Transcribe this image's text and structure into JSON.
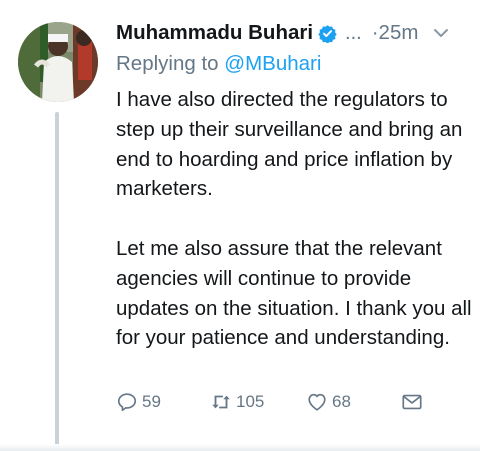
{
  "tweet": {
    "author_name": "Muhammadu Buhari",
    "handle_truncated": "...",
    "time": "·25m",
    "replying_prefix": "Replying to ",
    "replying_handle": "@MBuhari",
    "paragraphs": [
      "I have also directed the regulators to step up their surveillance and bring an end to hoarding and price inflation by marketers.",
      "Let me also assure that the relevant agencies will continue to provide updates on the situation. I thank you all for your patience and understanding."
    ],
    "actions": {
      "reply_count": "59",
      "retweet_count": "105",
      "like_count": "68"
    }
  },
  "icons": {
    "verified": "verified-badge-icon",
    "caret": "chevron-down-icon",
    "reply": "reply-icon",
    "retweet": "retweet-icon",
    "like": "heart-icon",
    "dm": "envelope-icon"
  },
  "colors": {
    "accent": "#1da1f2",
    "secondary_text": "#657786",
    "primary_text": "#14171a",
    "thread_line": "#c9d2d9"
  }
}
